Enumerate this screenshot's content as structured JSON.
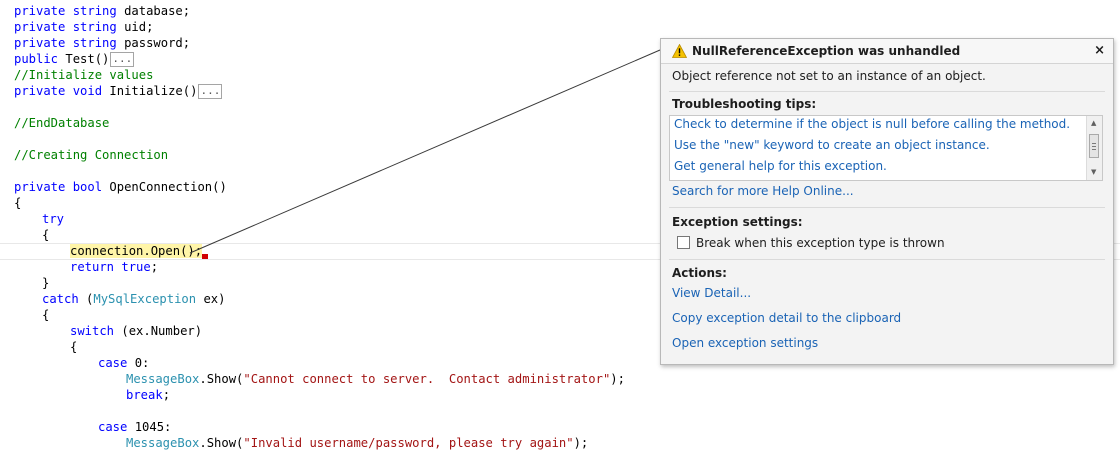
{
  "code": {
    "line1": {
      "kw": "private string",
      "rest": " database;"
    },
    "line2": {
      "kw": "private string",
      "rest": " uid;"
    },
    "line3": {
      "kw": "private string",
      "rest": " password;"
    },
    "line4": {
      "kw": "public",
      "rest": " Test()",
      "collapsed": "..."
    },
    "line5": {
      "comment": "//Initialize values"
    },
    "line6": {
      "kw": "private void",
      "rest": " Initialize()",
      "collapsed": "..."
    },
    "line7": {
      "comment": "//EndDatabase"
    },
    "line8": {
      "comment": "//Creating Connection"
    },
    "line9": {
      "kw": "private bool",
      "rest": " OpenConnection()"
    },
    "line10": {
      "text": "{"
    },
    "line11": {
      "kw": "try"
    },
    "line12": {
      "text": "{"
    },
    "line13": {
      "obj": "connection",
      "dot": ".",
      "method": "Open",
      "end": "();"
    },
    "line14": {
      "kw": "return true",
      "rest": ";"
    },
    "line15": {
      "text": "}"
    },
    "line16": {
      "kw": "catch",
      "open": " (",
      "type": "MySqlException",
      "rest": " ex)"
    },
    "line17": {
      "text": "{"
    },
    "line18": {
      "kw": "switch",
      "rest": " (ex.Number)"
    },
    "line19": {
      "text": "{"
    },
    "line20": {
      "kw": "case",
      "rest": " 0:"
    },
    "line21": {
      "type": "MessageBox",
      "rest": ".Show(",
      "str": "\"Cannot connect to server.  Contact administrator\"",
      "end": ");"
    },
    "line22": {
      "kw": "break",
      "rest": ";"
    },
    "line23": {
      "kw": "case",
      "rest": " 1045:"
    },
    "line24": {
      "type": "MessageBox",
      "rest": ".Show(",
      "str": "\"Invalid username/password, please try again\"",
      "end": ");"
    }
  },
  "popup": {
    "title": "NullReferenceException was unhandled",
    "close": "×",
    "message": "Object reference not set to an instance of an object.",
    "tips_label": "Troubleshooting tips:",
    "tips": [
      "Check to determine if the object is null before calling the method.",
      "Use the \"new\" keyword to create an object instance.",
      "Get general help for this exception."
    ],
    "search_online": "Search for more Help Online...",
    "settings_label": "Exception settings:",
    "break_checkbox_label": "Break when this exception type is thrown",
    "break_checked": false,
    "actions_label": "Actions:",
    "actions": [
      "View Detail...",
      "Copy exception detail to the clipboard",
      "Open exception settings"
    ]
  },
  "colors": {
    "keyword": "#0000ff",
    "comment": "#008000",
    "type": "#2b91af",
    "string": "#a31515",
    "link": "#1a63b5",
    "highlight": "#fff5a8",
    "warning": "#f5c200"
  },
  "icons": {
    "warning": "warning-icon",
    "close": "close-icon",
    "error_marker": "error-marker-icon"
  }
}
